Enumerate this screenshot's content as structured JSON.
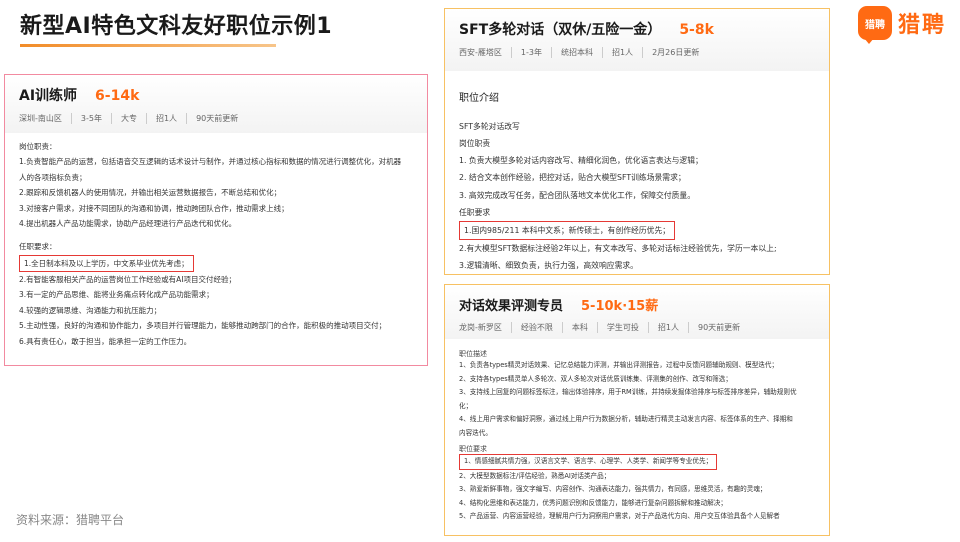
{
  "title": "新型AI特色文科友好职位示例1",
  "brand": {
    "badge_text": "猎聘",
    "name": "猎聘",
    "color": "#ff6a13"
  },
  "source": "资料来源：猎聘平台",
  "cards": {
    "left": {
      "job_title": "AI训练师",
      "salary": "6-14k",
      "meta": [
        "深圳-南山区",
        "3-5年",
        "大专",
        "招1人",
        "90天前更新"
      ],
      "duties_label": "岗位职责：",
      "duties": [
        "1.负责智能产品的运营，包括语音交互逻辑的话术设计与制作，并通过核心指标和数据的情况进行调整优化，对机器",
        "人的各项指标负责；",
        "2.跟踪和反馈机器人的使用情况，并输出相关运营数据报告，不断总结和优化；",
        "3.对接客户需求，对接不同团队的沟通和协调，推动跨团队合作，推动需求上线；",
        "4.提出机器人产品功能需求，协助产品经理进行产品迭代和优化。"
      ],
      "req_label": "任职要求：",
      "req_highlight": "1.全日制本科及以上学历，中文系毕业优先考虑；",
      "requirements": [
        "2.有智能客服相关产品的运营岗位工作经验或有AI项目交付经验；",
        "3.有一定的产品思维、能将业务痛点转化成产品功能需求；",
        "4.较强的逻辑思维、沟通能力和抗压能力；",
        "5.主动性强，良好的沟通和协作能力，多项目并行管理能力，能够推动跨部门的合作，能积极的推动项目交付；",
        "6.具有责任心，敢于担当，能承担一定的工作压力。"
      ]
    },
    "top_right": {
      "job_title": "SFT多轮对话（双休/五险一金）",
      "salary": "5-8k",
      "meta": [
        "西安-雁塔区",
        "1-3年",
        "统招本科",
        "招1人",
        "2月26日更新"
      ],
      "section_title": "职位介绍",
      "lines": [
        "SFT多轮对话改写",
        "岗位职责",
        "1. 负责大模型多轮对话内容改写、精细化润色，优化语言表达与逻辑；",
        "2. 结合文本创作经验，把控对话，贴合大模型SFT训练场景需求；",
        "3. 高效完成改写任务，配合团队落地文本优化工作，保障交付质量。",
        "任职要求"
      ],
      "req_highlight": "1.国内985/211 本科中文系；新传硕士，有创作经历优先；",
      "requirements": [
        "2.有大模型SFT数据标注经验2年以上，有文本改写、多轮对话标注经验优先，学历一本以上;",
        "3.逻辑清晰、细致负责，执行力强，高效响应需求。"
      ]
    },
    "bottom_right": {
      "job_title": "对话效果评测专员",
      "salary": "5-10k·15薪",
      "meta": [
        "龙岗-新罗区",
        "经验不限",
        "本科",
        "学生可投",
        "招1人",
        "90天前更新"
      ],
      "desc_label": "职位描述",
      "desc": [
        "1、负责各types精灵对话效果、记忆总结能力评测，并输出评测报告，过程中反馈问题辅助规则、模型迭代；",
        "2、支持各types精灵单人多轮次、双人多轮次对话优质训练集、评测集的创作、改写和筛选；",
        "3、支持线上回复的问题标签标注，输出体验排序，用于RM训练，并持续发掘体验排序与标签排序差异，辅助规则优",
        "化；",
        "4、线上用户需求和偏好洞察，通过线上用户行为数据分析，辅助进行精灵主动发言内容、标签体系的生产、择期和",
        "内容迭代。"
      ],
      "req_label": "职位要求",
      "req_highlight": "1、情感细腻共情力强，汉语言文学、语言学、心理学、人类学、新闻学等专业优先；",
      "requirements": [
        "2、大模型数据标注/评估经验，熟悉AI对话类产品；",
        "3、熟爱新鲜事物，强文字编写、内容创作、沟通表达能力，强共情力，有同感，思维灵活，有趣的灵魂；",
        "4、结构化思维和表达能力，优秀问题识别和反馈能力，能够进行复杂问题拆解和推动解决；",
        "5、产品运营、内容运营经验，理解用户行为洞察用户需求，对于产品迭代方向、用户交互体验具备个人见解者"
      ]
    }
  }
}
